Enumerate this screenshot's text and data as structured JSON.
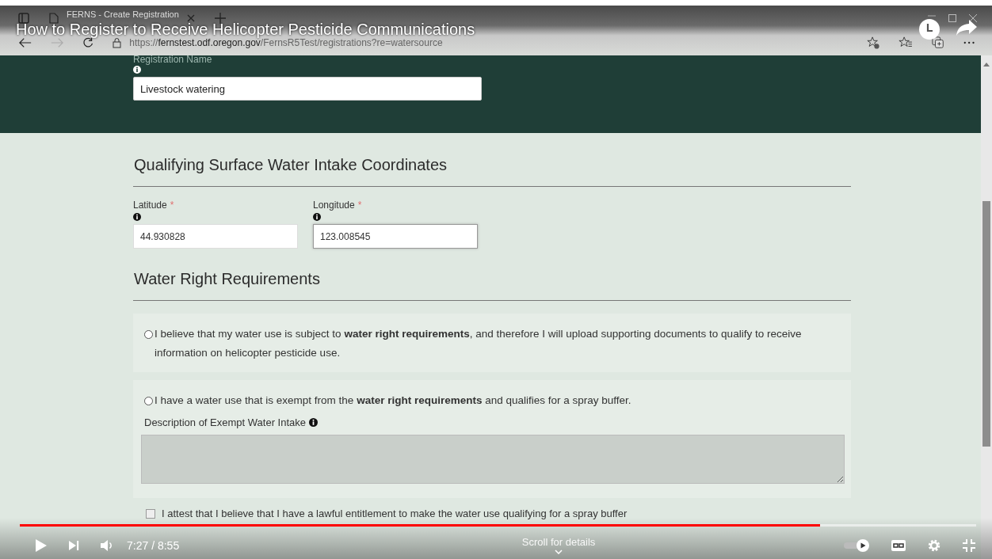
{
  "browser": {
    "tab_title": "FERNS - Create Registration",
    "url_scheme": "https://",
    "url_host": "fernstest.odf.oregon.gov",
    "url_path": "/FernsR5Test/registrations?re=watersource"
  },
  "registration": {
    "label": "Registration Name",
    "value": "Livestock watering"
  },
  "coordinates": {
    "heading": "Qualifying Surface Water Intake Coordinates",
    "fields": [
      {
        "label": "Latitude",
        "required_mark": "*",
        "value": "44.930828",
        "focused": false
      },
      {
        "label": "Longitude",
        "required_mark": "*",
        "value": "123.008545",
        "focused": true
      }
    ]
  },
  "water_rights": {
    "heading": "Water Right Requirements",
    "options": [
      {
        "text": "I believe that my water use is subject to **water right requirements**, and therefore I will upload supporting documents to qualify to receive information on helicopter pesticide use.",
        "selected": false
      },
      {
        "text": "I have a water use that is exempt from the **water right requirements** and qualifies for a spray buffer.",
        "selected": false,
        "description_label": "Description of Exempt Water Intake"
      }
    ],
    "attest": {
      "text": "I attest that I believe that I have a lawful entitlement to make the water use qualifying for a spray buffer",
      "checked": false
    }
  },
  "video": {
    "title": "How to Register to Receive Helicopter Pesticide Communications",
    "time": "7:27 / 8:55",
    "level": 0.837,
    "hint": "Scroll for details"
  }
}
